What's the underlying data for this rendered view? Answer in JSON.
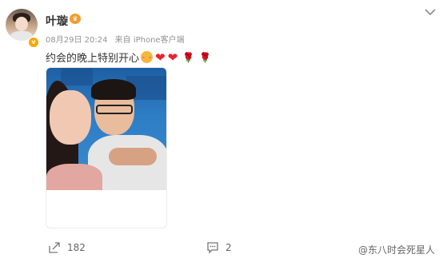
{
  "post": {
    "user": {
      "name": "叶璇",
      "verified": true
    },
    "meta": {
      "date": "08月29日 20:24",
      "source": "来自 iPhone客户端"
    },
    "text": "约会的晚上特别开心",
    "emojis": [
      "blush-face",
      "red-heart",
      "red-heart",
      "rose",
      "rose"
    ]
  },
  "actions": {
    "share_count": "182",
    "comment_count": "2"
  },
  "watermark": "@东八时会死星人",
  "colors": {
    "accent": "#f39b2f",
    "text": "#333333",
    "meta": "#939393",
    "heart": "#e8232f"
  }
}
